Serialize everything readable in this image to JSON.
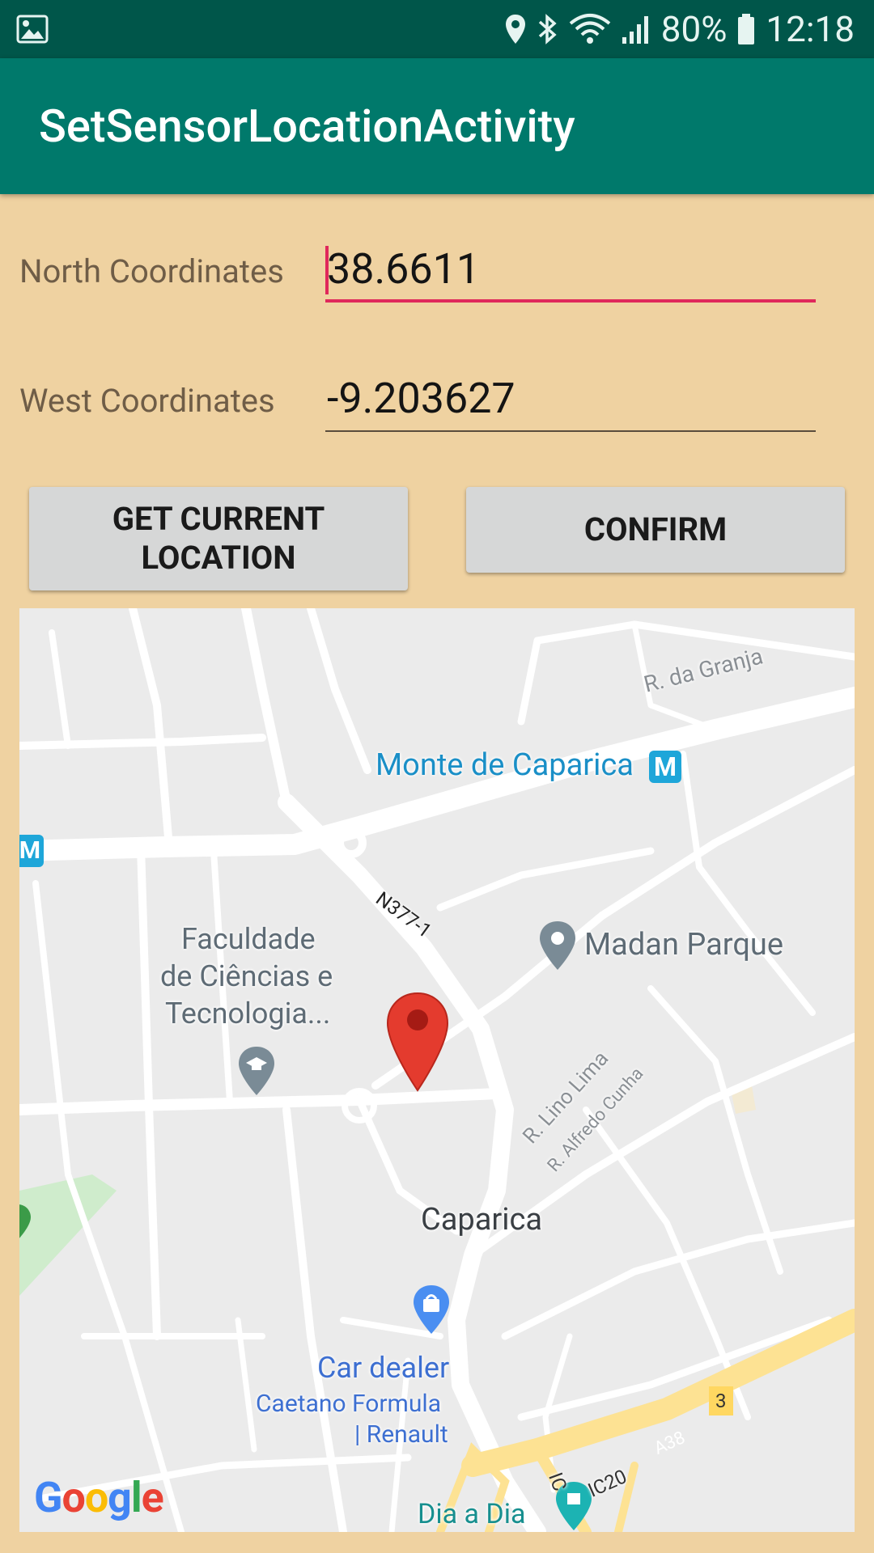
{
  "status_bar": {
    "battery": "80%",
    "time": "12:18"
  },
  "app_bar": {
    "title": "SetSensorLocationActivity"
  },
  "form": {
    "north_label": "North Coordinates",
    "north_value": "38.6611",
    "west_label": "West Coordinates",
    "west_value": "-9.203627"
  },
  "buttons": {
    "get_location_line1": "GET CURRENT",
    "get_location_line2": "LOCATION",
    "confirm": "CONFIRM"
  },
  "map": {
    "labels": {
      "r_granja": "R. da Granja",
      "monte": "Monte de Caparica",
      "n377": "N377-1",
      "madan": "Madan Parque",
      "faculdade_1": "Faculdade",
      "faculdade_2": "de Ciências e",
      "faculdade_3": "Tecnologia...",
      "lino": "R. Lino Lima",
      "alfredo": "R. Alfredo Cunha",
      "caparica": "Caparica",
      "car_dealer": "Car dealer",
      "caetano_1": "Caetano Formula",
      "caetano_2": "| Renault",
      "road_3": "3",
      "a38": "A38",
      "ic20": "IC20",
      "ic_partial": "IC",
      "dia": "Dia a Dia",
      "metro": "M"
    },
    "logo": {
      "G": "G",
      "o1": "o",
      "o2": "o",
      "g": "g",
      "l": "l",
      "e": "e"
    },
    "colors": {
      "metro": "#1ea6d9",
      "pin": "#e43b2e",
      "highway": "#fde293"
    }
  }
}
